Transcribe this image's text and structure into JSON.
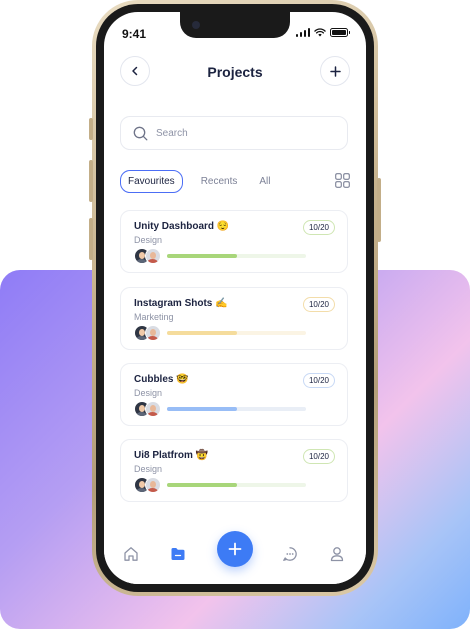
{
  "status_bar": {
    "time": "9:41"
  },
  "header": {
    "title": "Projects",
    "back_icon": "chevron-left-icon",
    "add_icon": "plus-icon"
  },
  "search": {
    "placeholder": "Search",
    "icon": "search-icon"
  },
  "tabs": [
    {
      "label": "Favourites",
      "active": true
    },
    {
      "label": "Recents",
      "active": false
    },
    {
      "label": "All",
      "active": false
    }
  ],
  "grid_toggle_icon": "grid-icon",
  "projects": [
    {
      "title": "Unity Dashboard 😌",
      "category": "Design",
      "count": "10/20",
      "progress": 0.5,
      "color": "#a8d67a",
      "track": "#eef6e8",
      "badge_border": "#cfe6b3"
    },
    {
      "title": "Instagram Shots ✍️",
      "category": "Marketing",
      "count": "10/20",
      "progress": 0.5,
      "color": "#f5dc9c",
      "track": "#fbf4e4",
      "badge_border": "#f3ddaa"
    },
    {
      "title": "Cubbles 🤓",
      "category": "Design",
      "count": "10/20",
      "progress": 0.5,
      "color": "#98bdf6",
      "track": "#e9eef6",
      "badge_border": "#c8d9f5"
    },
    {
      "title": "Ui8 Platfrom 🤠",
      "category": "Design",
      "count": "10/20",
      "progress": 0.5,
      "color": "#a8d67a",
      "track": "#eef6e8",
      "badge_border": "#cfe6b3"
    }
  ],
  "nav": {
    "items": [
      "home-icon",
      "folder-icon",
      "plus-icon",
      "chat-icon",
      "profile-icon"
    ],
    "active": "folder-icon",
    "accent": "#3d7bf5"
  }
}
